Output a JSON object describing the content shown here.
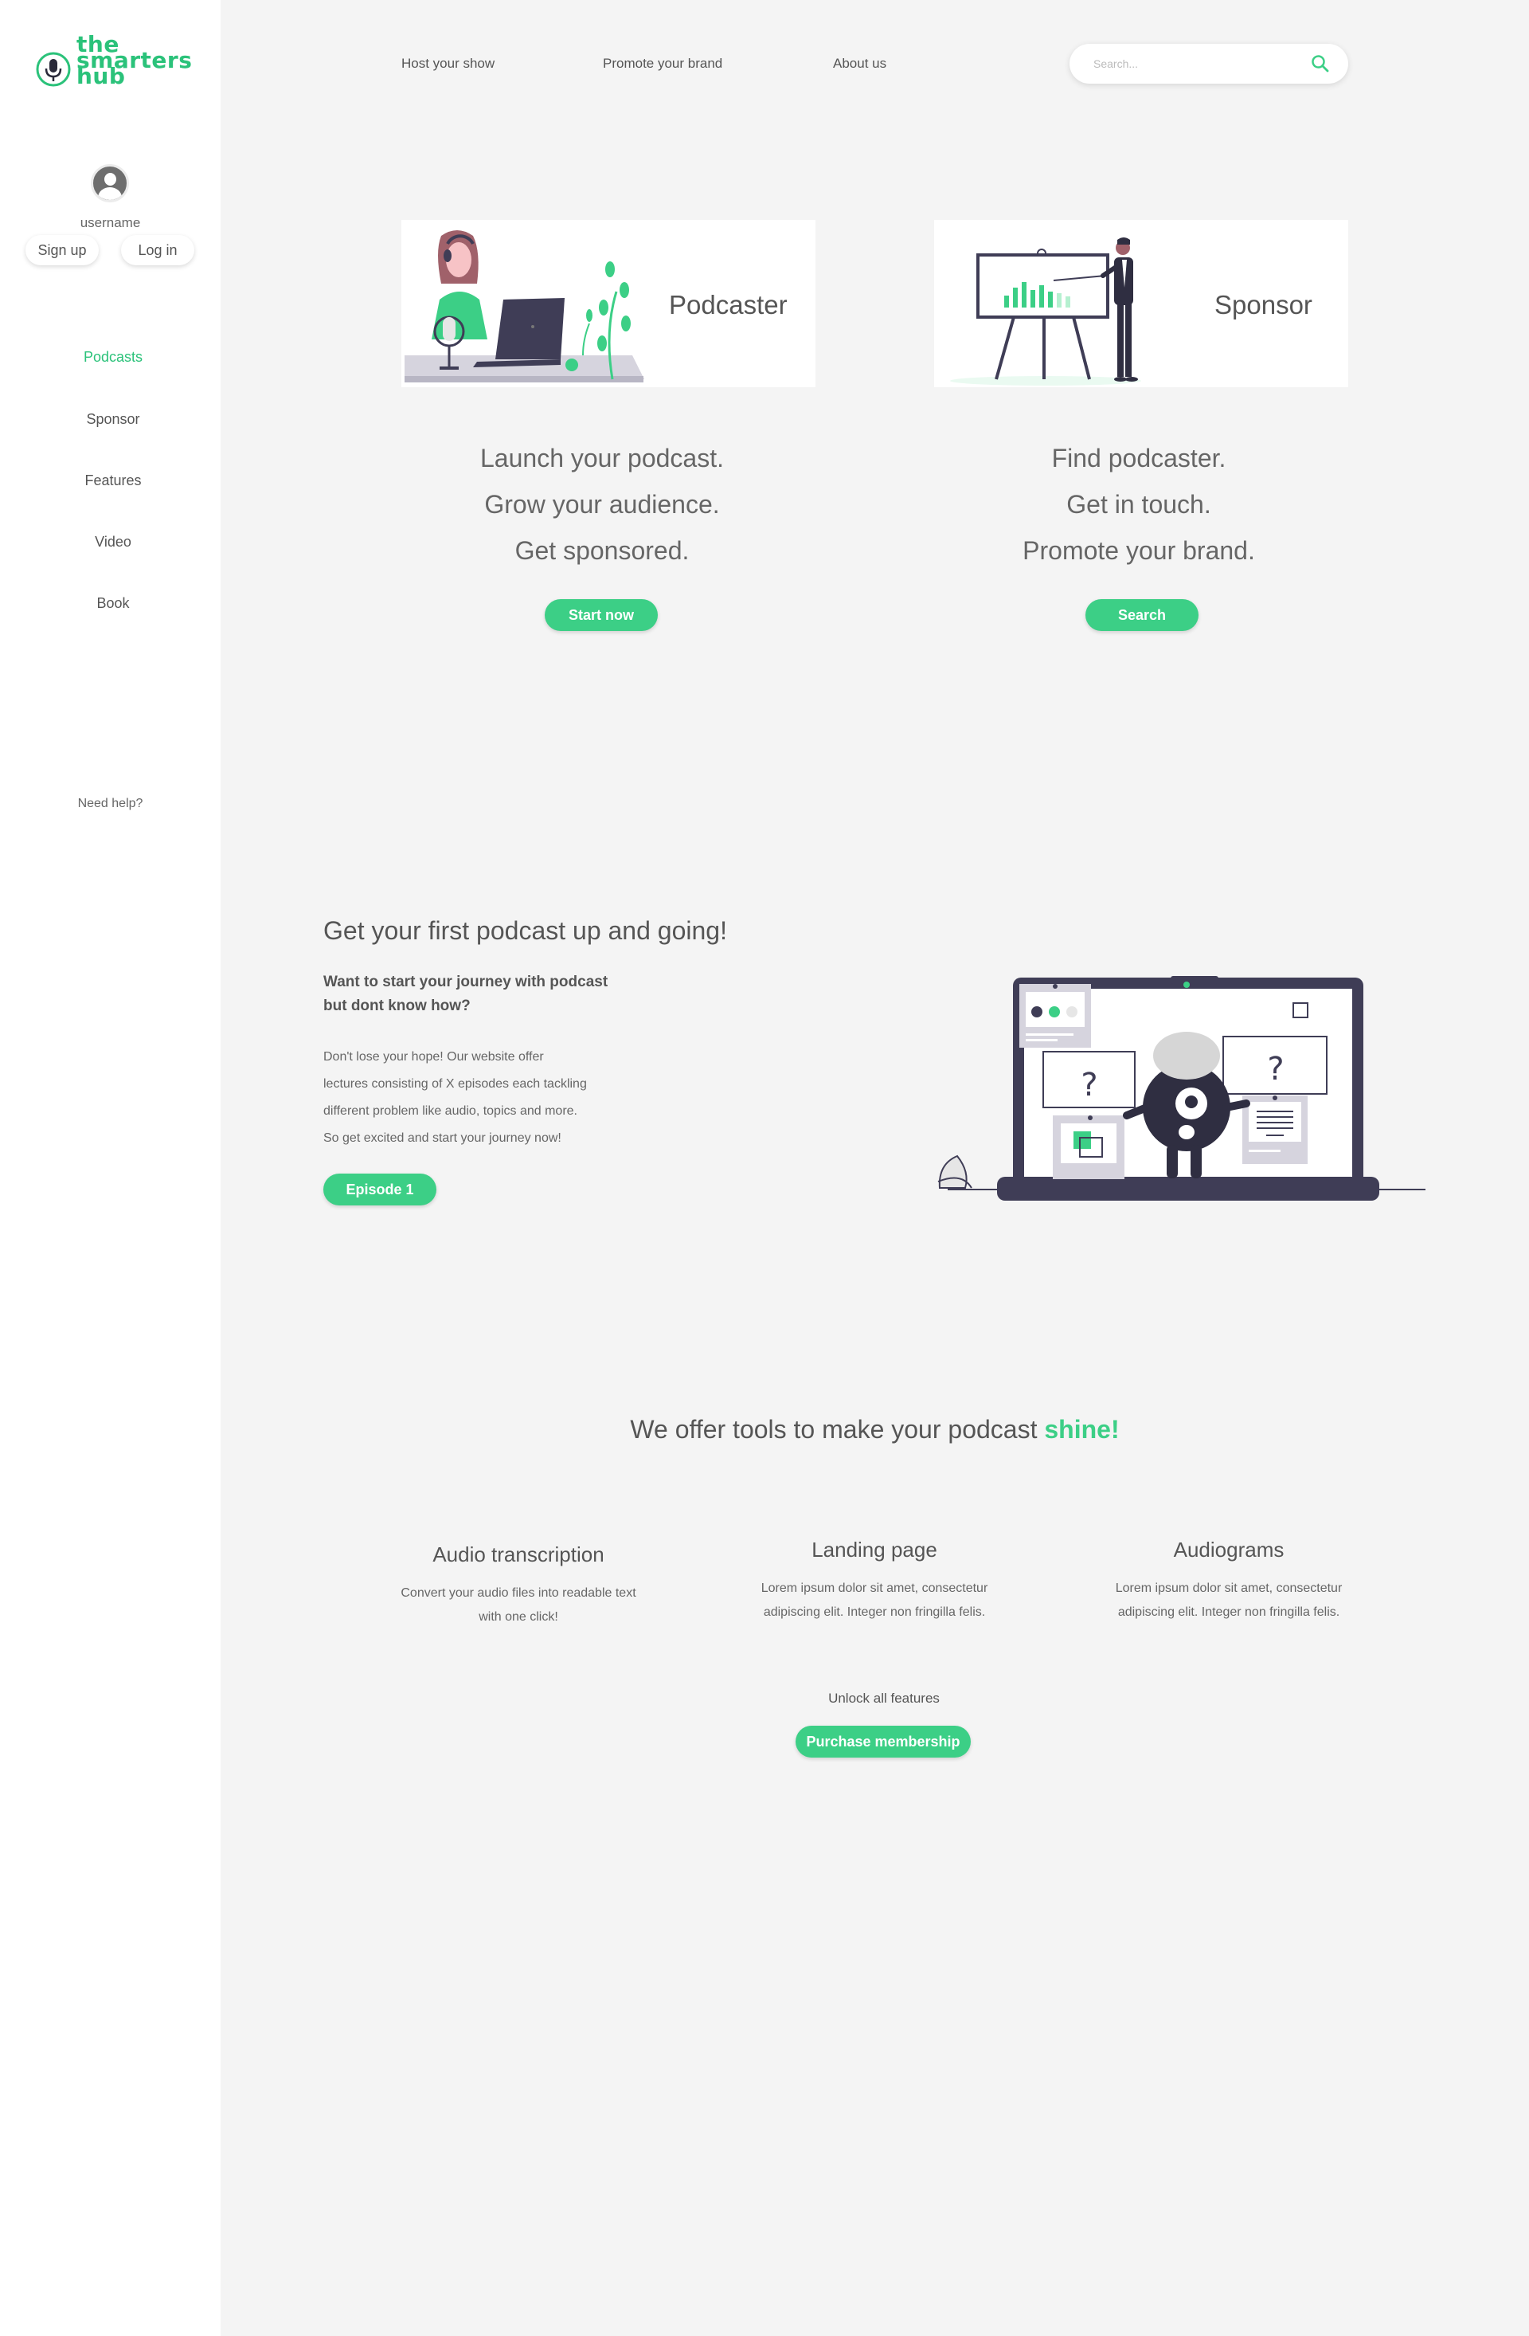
{
  "logo": {
    "lines": [
      "the",
      "smarters",
      "hub"
    ]
  },
  "sidebar": {
    "username": "username",
    "signup_label": "Sign up",
    "login_label": "Log in",
    "items": [
      {
        "label": "Podcasts"
      },
      {
        "label": "Sponsor"
      },
      {
        "label": "Features"
      },
      {
        "label": "Video"
      },
      {
        "label": "Book"
      }
    ],
    "need_help": "Need help?"
  },
  "topnav": {
    "links": [
      "Host your show",
      "Promote your brand",
      "About us"
    ],
    "search_placeholder": "Search..."
  },
  "cards": {
    "podcaster": {
      "title": "Podcaster",
      "lines": [
        "Launch your podcast.",
        "Grow your audience.",
        "Get sponsored."
      ],
      "button": "Start now"
    },
    "sponsor": {
      "title": "Sponsor",
      "lines": [
        "Find podcaster.",
        "Get in touch.",
        "Promote your brand."
      ],
      "button": "Search"
    }
  },
  "section2": {
    "title": "Get your first podcast up and going!",
    "subtitle_lines": [
      "Want to start your journey with podcast",
      "but dont know how?"
    ],
    "body_lines": [
      "Don't lose your hope! Our website offer",
      "lectures consisting  of X episodes each tackling",
      "different problem like audio, topics and more.",
      "So get excited and start your journey now!"
    ],
    "button": "Episode 1"
  },
  "section3": {
    "title_prefix": "We offer tools to make your podcast ",
    "title_highlight": "shine!",
    "features": [
      {
        "title": "Audio transcription",
        "lines": [
          "Convert your audio files into readable text",
          "with one click!"
        ]
      },
      {
        "title": "Landing page",
        "lines": [
          "Lorem ipsum dolor sit amet, consectetur",
          "adipiscing elit. Integer non fringilla felis."
        ]
      },
      {
        "title": "Audiograms",
        "lines": [
          "Lorem ipsum dolor sit amet, consectetur",
          "adipiscing elit. Integer non fringilla felis."
        ]
      }
    ],
    "unlock_text": "Unlock all features",
    "purchase_button": "Purchase membership"
  },
  "colors": {
    "accent": "#3ccf86",
    "logo": "#2bc27a",
    "sidebar_bg": "#ffffff",
    "page_bg": "#f4f4f4",
    "illustration_dark": "#3f3d56"
  }
}
